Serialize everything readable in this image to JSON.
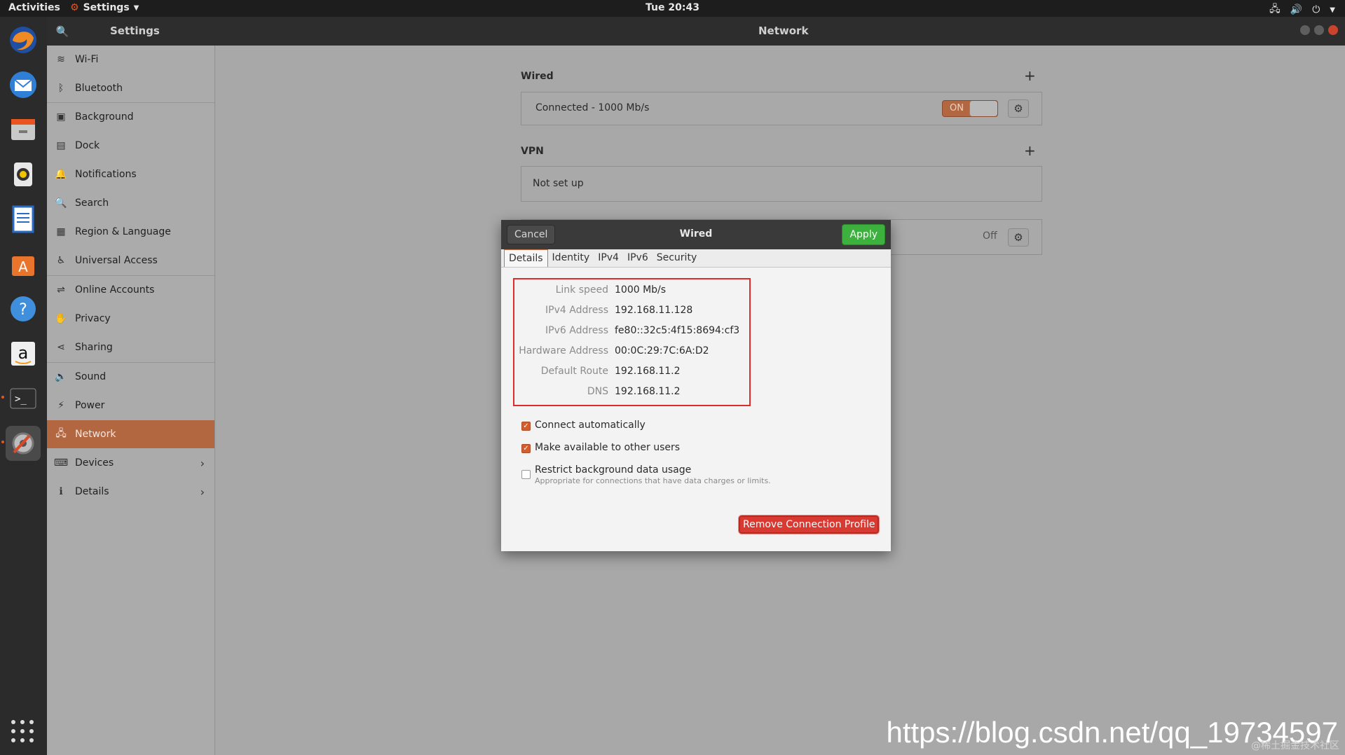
{
  "topbar": {
    "activities": "Activities",
    "app_menu": "Settings",
    "clock": "Tue 20:43"
  },
  "dock": {
    "icons": [
      "firefox-icon",
      "thunderbird-icon",
      "files-icon",
      "rhythmbox-icon",
      "writer-icon",
      "software-icon",
      "help-icon",
      "amazon-icon",
      "terminal-icon",
      "settings-icon"
    ]
  },
  "headerbar": {
    "sidebar_title": "Settings",
    "page_title": "Network"
  },
  "sidebar": {
    "items": [
      {
        "label": "Wi-Fi",
        "icon": "wifi-icon"
      },
      {
        "label": "Bluetooth",
        "icon": "bluetooth-icon"
      },
      {
        "label": "Background",
        "icon": "background-icon"
      },
      {
        "label": "Dock",
        "icon": "dock-icon"
      },
      {
        "label": "Notifications",
        "icon": "bell-icon"
      },
      {
        "label": "Search",
        "icon": "search-icon"
      },
      {
        "label": "Region & Language",
        "icon": "region-icon"
      },
      {
        "label": "Universal Access",
        "icon": "accessibility-icon"
      },
      {
        "label": "Online Accounts",
        "icon": "online-accounts-icon"
      },
      {
        "label": "Privacy",
        "icon": "hand-icon"
      },
      {
        "label": "Sharing",
        "icon": "share-icon"
      },
      {
        "label": "Sound",
        "icon": "speaker-icon"
      },
      {
        "label": "Power",
        "icon": "power-icon"
      },
      {
        "label": "Network",
        "icon": "network-icon"
      },
      {
        "label": "Devices",
        "icon": "devices-icon"
      },
      {
        "label": "Details",
        "icon": "info-icon"
      }
    ],
    "selected": "Network"
  },
  "main": {
    "wired_label": "Wired",
    "wired_status": "Connected - 1000 Mb/s",
    "wired_toggle": "ON",
    "vpn_label": "VPN",
    "vpn_status": "Not set up",
    "proxy_state": "Off"
  },
  "dialog": {
    "cancel": "Cancel",
    "title": "Wired",
    "apply": "Apply",
    "tabs": [
      "Details",
      "Identity",
      "IPv4",
      "IPv6",
      "Security"
    ],
    "active_tab": "Details",
    "details": [
      {
        "key": "Link speed",
        "value": "1000 Mb/s"
      },
      {
        "key": "IPv4 Address",
        "value": "192.168.11.128"
      },
      {
        "key": "IPv6 Address",
        "value": "fe80::32c5:4f15:8694:cf3"
      },
      {
        "key": "Hardware Address",
        "value": "00:0C:29:7C:6A:D2"
      },
      {
        "key": "Default Route",
        "value": "192.168.11.2"
      },
      {
        "key": "DNS",
        "value": "192.168.11.2"
      }
    ],
    "connect_automatically": "Connect automatically",
    "available_to_others": "Make available to other users",
    "restrict_background": "Restrict background data usage",
    "restrict_hint": "Appropriate for connections that have data charges or limits.",
    "remove_button": "Remove Connection Profile"
  },
  "watermark": {
    "url": "https://blog.csdn.net/qq_19734597",
    "overlay": "@稀土掘金技术社区"
  },
  "colors": {
    "accent": "#b26740",
    "apply": "#3db13d",
    "danger": "#d83a32",
    "highlight_box": "#e02b2b"
  }
}
